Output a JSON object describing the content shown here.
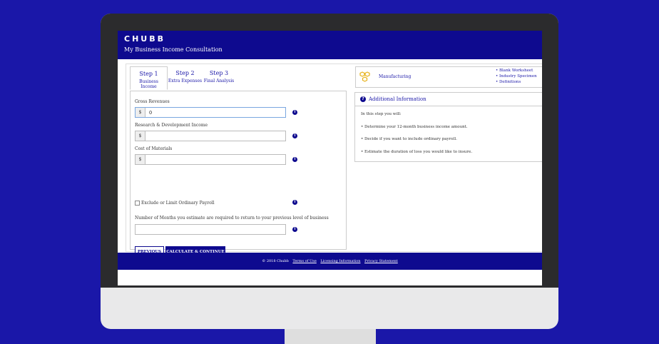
{
  "header": {
    "logo": "CHUBB",
    "app_title": "My Business Income Consultation"
  },
  "tabs": [
    {
      "step": "Step 1",
      "label": "Business Income"
    },
    {
      "step": "Step 2",
      "label": "Extra Expenses"
    },
    {
      "step": "Step 3",
      "label": "Final Analysis"
    }
  ],
  "form": {
    "gross_revenues": {
      "label": "Gross Revenues",
      "prefix": "$",
      "value": "0"
    },
    "rd_income": {
      "label": "Research & Development Income",
      "prefix": "$",
      "value": ""
    },
    "cost_of_materials": {
      "label": "Cost of Materials",
      "prefix": "$",
      "value": ""
    },
    "payroll_checkbox": {
      "label": "Exclude or Limit Ordinary Payroll"
    },
    "months": {
      "label": "Number of Months you estimate are required to return to your previous level of business",
      "value": ""
    },
    "previous_label": "PREVIOUS",
    "continue_label": "CALCULATE & CONTINUE"
  },
  "industry": {
    "name": "Manufacturing",
    "links": [
      "• Blank Worksheet",
      "• Industry Specimen",
      "• Definitions"
    ]
  },
  "additional_info": {
    "title": "Additional Information",
    "intro": "In this step you will:",
    "items": [
      "• Determine your 12-month business income amount.",
      "• Decide if you want to include ordinary payroll.",
      "• Estimate the duration of loss you would like to insure."
    ]
  },
  "footer": {
    "copyright": "© 2018 Chubb",
    "links": [
      "Terms of Use",
      "Licensing Information",
      "Privacy Statement"
    ]
  },
  "colors": {
    "brand_navy": "#0e0a8f",
    "background": "#1a17a8"
  },
  "icons": [
    "info-icon",
    "question-icon",
    "honeycomb-icon",
    "checkbox-icon"
  ]
}
